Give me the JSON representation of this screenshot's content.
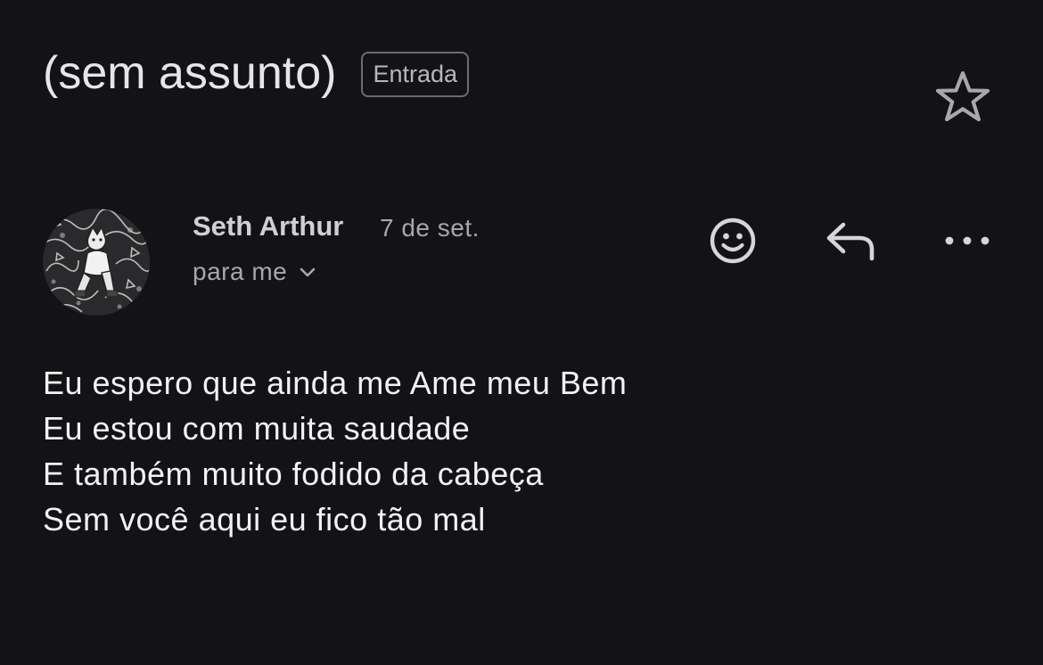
{
  "header": {
    "subject": "(sem assunto)",
    "label": "Entrada",
    "star_icon": "star-outline-icon"
  },
  "message": {
    "sender": "Seth Arthur",
    "date": "7 de set.",
    "recipient": "para me",
    "recipient_icon": "chevron-down-icon",
    "avatar": "sender-avatar-image",
    "actions": [
      {
        "name": "emoji-reaction",
        "icon": "smile-icon"
      },
      {
        "name": "reply",
        "icon": "reply-arrow-icon"
      },
      {
        "name": "more-options",
        "icon": "more-horizontal-icon"
      }
    ],
    "body": [
      "Eu espero que ainda me Ame meu Bem",
      "Eu estou com muita saudade",
      "E também muito fodido da cabeça",
      "Sem você aqui eu fico tão mal"
    ]
  },
  "colors": {
    "background": "#131316",
    "text_primary": "#f2f2f4",
    "text_secondary": "#a8a8ac",
    "chip_border": "#6b6b70"
  }
}
